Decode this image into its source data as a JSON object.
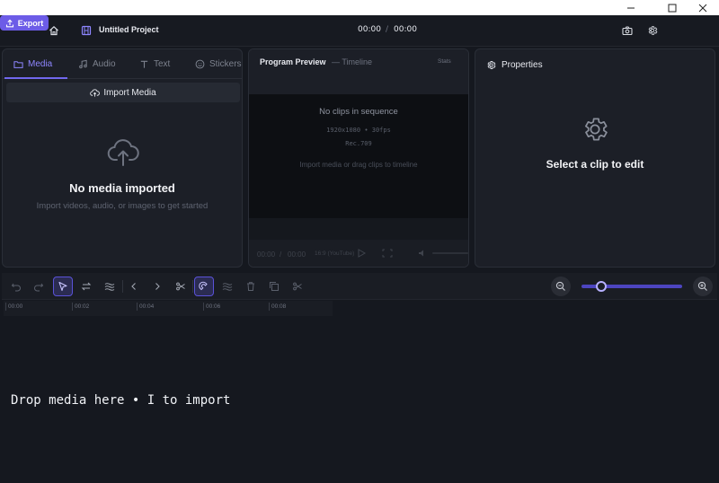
{
  "window": {
    "controls": [
      "minimize-icon",
      "maximize-icon",
      "close-icon"
    ]
  },
  "header": {
    "project_title": "Untitled Project",
    "time_current": "00:00",
    "time_separator": "/",
    "time_total": "00:00",
    "export_label": "Export"
  },
  "media_panel": {
    "tabs": [
      {
        "label": "Media",
        "icon": "folder-icon",
        "active": true
      },
      {
        "label": "Audio",
        "icon": "music-icon",
        "active": false
      },
      {
        "label": "Text",
        "icon": "text-icon",
        "active": false
      },
      {
        "label": "Stickers",
        "icon": "sticker-icon",
        "active": false
      }
    ],
    "import_label": "Import Media",
    "empty_title": "No media imported",
    "empty_subtitle": "Import videos, audio, or images to get started"
  },
  "preview": {
    "title": "Program Preview",
    "subtitle": "— Timeline",
    "stats_label": "Stats",
    "no_clips": "No clips in sequence",
    "resolution": "1920x1080 • 30fps",
    "rec": "Rec.709",
    "hint": "Import media or drag clips to timeline",
    "time_current": "00:00",
    "time_separator": "/",
    "time_total": "00:00",
    "aspect": "16:9 (YouTube)"
  },
  "properties": {
    "title": "Properties",
    "empty": "Select a clip to edit"
  },
  "timeline": {
    "ruler": [
      "00:00",
      "00:02",
      "00:04",
      "00:06",
      "00:08"
    ],
    "zoom_level": 0.2,
    "drop_message": "Drop media here • I to import"
  },
  "colors": {
    "accent": "#6c5ce7",
    "active_tab": "#8e86ff",
    "panel_bg": "#1c1f27",
    "app_bg": "#15181f"
  }
}
